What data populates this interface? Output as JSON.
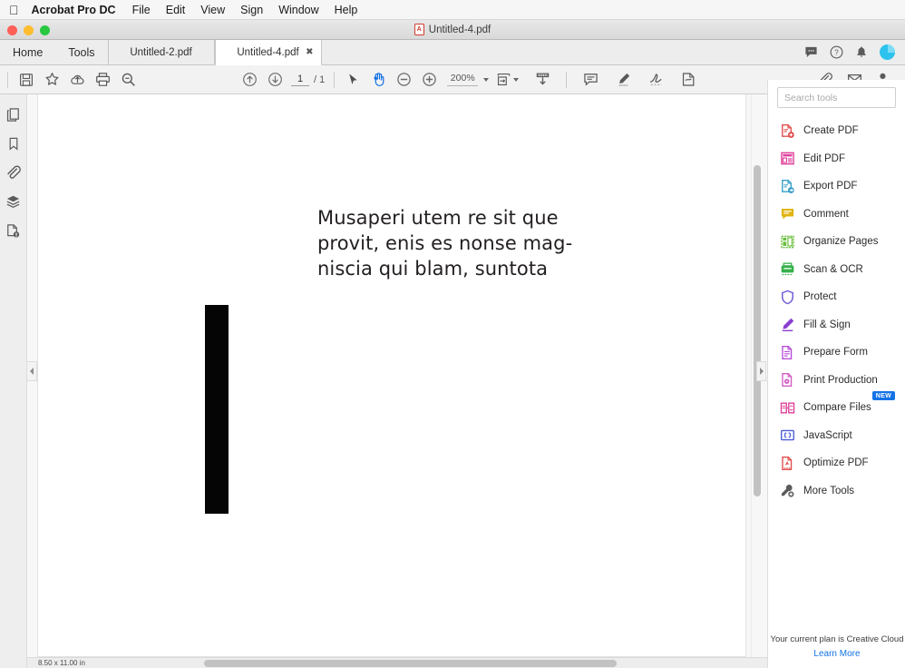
{
  "menubar": {
    "apple": "apple-logo",
    "app_name": "Acrobat Pro DC",
    "items": [
      "File",
      "Edit",
      "View",
      "Sign",
      "Window",
      "Help"
    ]
  },
  "window": {
    "title": "Untitled-4.pdf"
  },
  "tabbar": {
    "home": "Home",
    "tools": "Tools",
    "tabs": [
      {
        "label": "Untitled-2.pdf",
        "active": false,
        "close": ""
      },
      {
        "label": "Untitled-4.pdf",
        "active": true,
        "close": "✖"
      }
    ],
    "right_icons": [
      "comment-icon",
      "help-icon",
      "bell-icon",
      "avatar"
    ]
  },
  "toolbar": {
    "left_icons": [
      "save-icon",
      "star-icon",
      "upload-cloud-icon",
      "print-icon",
      "zoom-search-icon"
    ],
    "page_prev": "previous-page-icon",
    "page_next": "next-page-icon",
    "page_current": "1",
    "page_separator": "/ 1",
    "select_tool": "select-arrow-icon",
    "hand_tool": "hand-icon",
    "zoom_out": "zoom-out-icon",
    "zoom_in": "zoom-in-icon",
    "zoom_value": "200%",
    "fit_page": "fit-page-icon",
    "fit_width": "fit-width-icon",
    "comment_tool": "comment-box-icon",
    "highlight_tool": "highlighter-icon",
    "signature_tool": "signature-icon",
    "stamp_tool": "stamp-icon",
    "right_icons": [
      "attach-icon",
      "email-icon",
      "share-user-icon"
    ]
  },
  "leftrail": {
    "items": [
      "page-thumbnails-icon",
      "bookmarks-icon",
      "attachments-icon",
      "layers-icon",
      "document-info-icon"
    ]
  },
  "document": {
    "heading_lines": [
      "Musaperi utem re sit que",
      "provit, enis es nonse mag-",
      "niscia qui blam, suntota"
    ],
    "heading_text": "Musaperi utem re sit que provit, enis es nonse mag- niscia qui blam, suntota"
  },
  "statusbar": {
    "page_size": "8.50 x 11.00 in"
  },
  "rightpanel": {
    "search_placeholder": "Search tools",
    "search_value": "",
    "tools": [
      {
        "label": "Create PDF",
        "icon": "create-pdf-icon",
        "color": "#e34f4f",
        "badge": ""
      },
      {
        "label": "Edit PDF",
        "icon": "edit-pdf-icon",
        "color": "#e0409a",
        "badge": ""
      },
      {
        "label": "Export PDF",
        "icon": "export-pdf-icon",
        "color": "#3aa0c8",
        "badge": ""
      },
      {
        "label": "Comment",
        "icon": "comment-icon",
        "color": "#e0b310",
        "badge": ""
      },
      {
        "label": "Organize Pages",
        "icon": "organize-pages-icon",
        "color": "#6cbf3f",
        "badge": ""
      },
      {
        "label": "Scan & OCR",
        "icon": "scan-ocr-icon",
        "color": "#35b14a",
        "badge": ""
      },
      {
        "label": "Protect",
        "icon": "protect-shield-icon",
        "color": "#6a59d6",
        "badge": ""
      },
      {
        "label": "Fill & Sign",
        "icon": "fill-sign-icon",
        "color": "#8a3fd0",
        "badge": ""
      },
      {
        "label": "Prepare Form",
        "icon": "prepare-form-icon",
        "color": "#b84fd8",
        "badge": ""
      },
      {
        "label": "Print Production",
        "icon": "print-production-icon",
        "color": "#d35bc4",
        "badge": ""
      },
      {
        "label": "Compare Files",
        "icon": "compare-files-icon",
        "color": "#e0409a",
        "badge": "NEW"
      },
      {
        "label": "JavaScript",
        "icon": "javascript-icon",
        "color": "#4a5fd8",
        "badge": ""
      },
      {
        "label": "Optimize PDF",
        "icon": "optimize-pdf-icon",
        "color": "#e34f4f",
        "badge": ""
      },
      {
        "label": "More Tools",
        "icon": "more-tools-icon",
        "color": "#5a5a5a",
        "badge": ""
      }
    ],
    "plan_text": "Your current plan is Creative Cloud",
    "plan_link": "Learn More"
  },
  "colors": {
    "accent": "#1473e6",
    "active_tool": "#1473e6",
    "avatar": "#2ec3ee"
  }
}
